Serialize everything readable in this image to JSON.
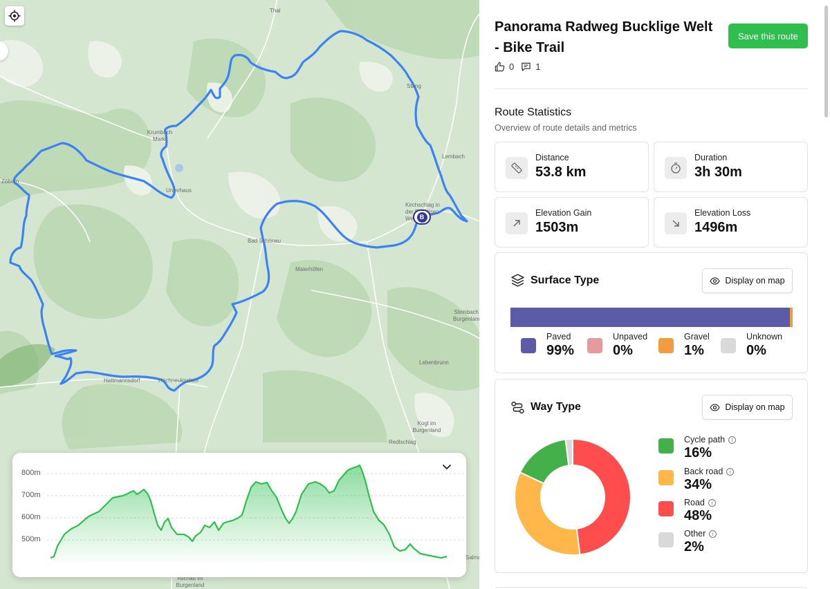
{
  "map": {
    "places": [
      "Thal",
      "Stang",
      "Krumbach Markt",
      "Lembach",
      "Zöbern",
      "Unterhaus",
      "Kirchschlag in der Buckligen Welt",
      "Bad Schönau",
      "Maierhöfen",
      "Steinbach Burgenland",
      "Lebenbrunn",
      "Hattmannsdorf",
      "Hochneukirchen",
      "Kogl im Burgenland",
      "Redlschlag",
      "Salmannsdorf",
      "Aschau im Burgenland"
    ],
    "end_marker": "B",
    "route_color": "#3b82f6"
  },
  "elevation": {
    "y_ticks": [
      "800m",
      "700m",
      "600m",
      "500m"
    ],
    "line_color": "#2fbf4f"
  },
  "route": {
    "title": "Panorama Radweg Bucklige Welt - Bike Trail",
    "save_label": "Save this route",
    "likes": "0",
    "comments": "1"
  },
  "stats": {
    "title": "Route Statistics",
    "subtitle": "Overview of route details and metrics",
    "distance": {
      "label": "Distance",
      "value": "53.8 km"
    },
    "duration": {
      "label": "Duration",
      "value": "3h 30m"
    },
    "gain": {
      "label": "Elevation Gain",
      "value": "1503m"
    },
    "loss": {
      "label": "Elevation Loss",
      "value": "1496m"
    }
  },
  "surface": {
    "title": "Surface Type",
    "display_label": "Display on map",
    "items": [
      {
        "label": "Paved",
        "value": "99%",
        "color": "#5b5ba8"
      },
      {
        "label": "Unpaved",
        "value": "0%",
        "color": "#e79a9a"
      },
      {
        "label": "Gravel",
        "value": "1%",
        "color": "#f39c3d"
      },
      {
        "label": "Unknown",
        "value": "0%",
        "color": "#d9d9d9"
      }
    ]
  },
  "way": {
    "title": "Way Type",
    "display_label": "Display on map",
    "items": [
      {
        "label": "Cycle path",
        "value": "16%",
        "color": "#43b04a"
      },
      {
        "label": "Back road",
        "value": "34%",
        "color": "#ffb74a"
      },
      {
        "label": "Road",
        "value": "48%",
        "color": "#ff4d4d"
      },
      {
        "label": "Other",
        "value": "2%",
        "color": "#d9d9d9"
      }
    ]
  }
}
